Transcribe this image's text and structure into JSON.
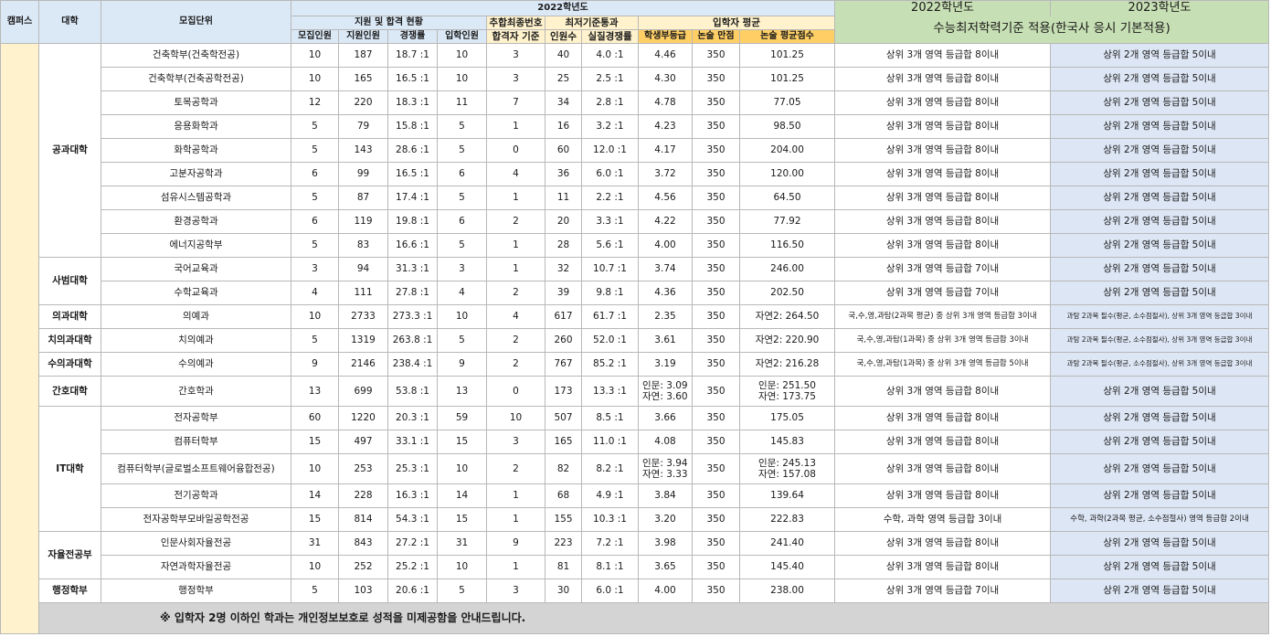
{
  "header": {
    "campus": "캠퍼스",
    "college": "대학",
    "unit": "모집단위",
    "year2022": "2022학년도",
    "group_apply": "지원 및 합격 현황",
    "group_extra": "추합최종번호",
    "group_min": "최저기준통과",
    "group_avg": "입학자 평균",
    "col_recruit": "모집인원",
    "col_applicants": "지원인원",
    "col_ratio": "경쟁률",
    "col_admitted": "입학인원",
    "col_extra": "합격자 기준",
    "col_passcount": "인원수",
    "col_realratio": "실질경쟁률",
    "col_grade": "학생부등급",
    "col_essay_full": "논술 만점",
    "col_essay_avg": "논술 평균점수",
    "csat_2022_year": "2022학년도",
    "csat_2023_year": "2023학년도",
    "csat_title": "수능최저학력기준 적용(한국사 응시 기본적용)"
  },
  "colleges": {
    "eng": "공과대학",
    "edu": "사범대학",
    "med": "의과대학",
    "dent": "치의과대학",
    "vet": "수의과대학",
    "nurse": "간호대학",
    "it": "IT대학",
    "free": "자율전공부",
    "admin": "행정학부"
  },
  "rows": [
    {
      "unit": "건축학부(건축학전공)",
      "recruit": "10",
      "applicants": "187",
      "ratio": "18.7 :1",
      "admitted": "10",
      "extra": "3",
      "pass": "40",
      "real": "4.0 :1",
      "grade": "4.46",
      "full": "350",
      "avg": "101.25",
      "c22": "상위 3개 영역 등급합 8이내",
      "c23": "상위 2개 영역 등급합 5이내"
    },
    {
      "unit": "건축학부(건축공학전공)",
      "recruit": "10",
      "applicants": "165",
      "ratio": "16.5 :1",
      "admitted": "10",
      "extra": "3",
      "pass": "25",
      "real": "2.5 :1",
      "grade": "4.30",
      "full": "350",
      "avg": "101.25",
      "c22": "상위 3개 영역 등급합 8이내",
      "c23": "상위 2개 영역 등급합 5이내"
    },
    {
      "unit": "토목공학과",
      "recruit": "12",
      "applicants": "220",
      "ratio": "18.3 :1",
      "admitted": "11",
      "extra": "7",
      "pass": "34",
      "real": "2.8 :1",
      "grade": "4.78",
      "full": "350",
      "avg": "77.05",
      "c22": "상위 3개 영역 등급합 8이내",
      "c23": "상위 2개 영역 등급합 5이내"
    },
    {
      "unit": "응용화학과",
      "recruit": "5",
      "applicants": "79",
      "ratio": "15.8 :1",
      "admitted": "5",
      "extra": "1",
      "pass": "16",
      "real": "3.2 :1",
      "grade": "4.23",
      "full": "350",
      "avg": "98.50",
      "c22": "상위 3개 영역 등급합 8이내",
      "c23": "상위 2개 영역 등급합 5이내"
    },
    {
      "unit": "화학공학과",
      "recruit": "5",
      "applicants": "143",
      "ratio": "28.6 :1",
      "admitted": "5",
      "extra": "0",
      "pass": "60",
      "real": "12.0 :1",
      "grade": "4.17",
      "full": "350",
      "avg": "204.00",
      "c22": "상위 3개 영역 등급합 8이내",
      "c23": "상위 2개 영역 등급합 5이내"
    },
    {
      "unit": "고분자공학과",
      "recruit": "6",
      "applicants": "99",
      "ratio": "16.5 :1",
      "admitted": "6",
      "extra": "4",
      "pass": "36",
      "real": "6.0 :1",
      "grade": "3.72",
      "full": "350",
      "avg": "120.00",
      "c22": "상위 3개 영역 등급합 8이내",
      "c23": "상위 2개 영역 등급합 5이내"
    },
    {
      "unit": "섬유시스템공학과",
      "recruit": "5",
      "applicants": "87",
      "ratio": "17.4 :1",
      "admitted": "5",
      "extra": "1",
      "pass": "11",
      "real": "2.2 :1",
      "grade": "4.56",
      "full": "350",
      "avg": "64.50",
      "c22": "상위 3개 영역 등급합 8이내",
      "c23": "상위 2개 영역 등급합 5이내"
    },
    {
      "unit": "환경공학과",
      "recruit": "6",
      "applicants": "119",
      "ratio": "19.8 :1",
      "admitted": "6",
      "extra": "2",
      "pass": "20",
      "real": "3.3 :1",
      "grade": "4.22",
      "full": "350",
      "avg": "77.92",
      "c22": "상위 3개 영역 등급합 8이내",
      "c23": "상위 2개 영역 등급합 5이내"
    },
    {
      "unit": "에너지공학부",
      "recruit": "5",
      "applicants": "83",
      "ratio": "16.6 :1",
      "admitted": "5",
      "extra": "1",
      "pass": "28",
      "real": "5.6 :1",
      "grade": "4.00",
      "full": "350",
      "avg": "116.50",
      "c22": "상위 3개 영역 등급합 8이내",
      "c23": "상위 2개 영역 등급합 5이내"
    },
    {
      "unit": "국어교육과",
      "recruit": "3",
      "applicants": "94",
      "ratio": "31.3 :1",
      "admitted": "3",
      "extra": "1",
      "pass": "32",
      "real": "10.7 :1",
      "grade": "3.74",
      "full": "350",
      "avg": "246.00",
      "c22": "상위 3개 영역 등급합 7이내",
      "c23": "상위 2개 영역 등급합 5이내"
    },
    {
      "unit": "수학교육과",
      "recruit": "4",
      "applicants": "111",
      "ratio": "27.8 :1",
      "admitted": "4",
      "extra": "2",
      "pass": "39",
      "real": "9.8 :1",
      "grade": "4.36",
      "full": "350",
      "avg": "202.50",
      "c22": "상위 3개 영역 등급합 7이내",
      "c23": "상위 2개 영역 등급합 5이내"
    },
    {
      "unit": "의예과",
      "recruit": "10",
      "applicants": "2733",
      "ratio": "273.3 :1",
      "admitted": "10",
      "extra": "4",
      "pass": "617",
      "real": "61.7 :1",
      "grade": "2.35",
      "full": "350",
      "avg": "자연2: 264.50",
      "c22": "국,수,영,과탐(2과목 평균) 중 상위 3개 영역 등급합 3이내",
      "c23": "과탐 2과목 필수(평균, 소수점절사), 상위 3개 영역 등급합 3이내"
    },
    {
      "unit": "치의예과",
      "recruit": "5",
      "applicants": "1319",
      "ratio": "263.8 :1",
      "admitted": "5",
      "extra": "2",
      "pass": "260",
      "real": "52.0 :1",
      "grade": "3.61",
      "full": "350",
      "avg": "자연2: 220.90",
      "c22": "국,수,영,과탐(1과목) 중 상위 3개 영역 등급합 3이내",
      "c23": "과탐 2과목 필수(평균, 소수점절사), 상위 3개 영역 등급합 3이내"
    },
    {
      "unit": "수의예과",
      "recruit": "9",
      "applicants": "2146",
      "ratio": "238.4 :1",
      "admitted": "9",
      "extra": "2",
      "pass": "767",
      "real": "85.2 :1",
      "grade": "3.19",
      "full": "350",
      "avg": "자연2: 216.28",
      "c22": "국,수,영,과탐(1과목) 중 상위 3개 영역 등급합 5이내",
      "c23": "과탐 2과목 필수(평균, 소수점절사), 상위 3개 영역 등급합 3이내"
    },
    {
      "unit": "간호학과",
      "recruit": "13",
      "applicants": "699",
      "ratio": "53.8 :1",
      "admitted": "13",
      "extra": "0",
      "pass": "173",
      "real": "13.3 :1",
      "grade": "인문: 3.09",
      "grade2": "자연: 3.60",
      "full": "350",
      "avg": "인문: 251.50",
      "avg2": "자연: 173.75",
      "c22": "상위 3개 영역 등급합 8이내",
      "c23": "상위 2개 영역 등급합 5이내"
    },
    {
      "unit": "전자공학부",
      "recruit": "60",
      "applicants": "1220",
      "ratio": "20.3 :1",
      "admitted": "59",
      "extra": "10",
      "pass": "507",
      "real": "8.5 :1",
      "grade": "3.66",
      "full": "350",
      "avg": "175.05",
      "c22": "상위 3개 영역 등급합 8이내",
      "c23": "상위 2개 영역 등급합 5이내"
    },
    {
      "unit": "컴퓨터학부",
      "recruit": "15",
      "applicants": "497",
      "ratio": "33.1 :1",
      "admitted": "15",
      "extra": "3",
      "pass": "165",
      "real": "11.0 :1",
      "grade": "4.08",
      "full": "350",
      "avg": "145.83",
      "c22": "상위 3개 영역 등급합 8이내",
      "c23": "상위 2개 영역 등급합 5이내"
    },
    {
      "unit": "컴퓨터학부(글로벌소프트웨어융합전공)",
      "recruit": "10",
      "applicants": "253",
      "ratio": "25.3 :1",
      "admitted": "10",
      "extra": "2",
      "pass": "82",
      "real": "8.2 :1",
      "grade": "인문: 3.94",
      "grade2": "자연: 3.33",
      "full": "350",
      "avg": "인문: 245.13",
      "avg2": "자연: 157.08",
      "c22": "상위 3개 영역 등급합 8이내",
      "c23": "상위 2개 영역 등급합 5이내"
    },
    {
      "unit": "전기공학과",
      "recruit": "14",
      "applicants": "228",
      "ratio": "16.3 :1",
      "admitted": "14",
      "extra": "1",
      "pass": "68",
      "real": "4.9 :1",
      "grade": "3.84",
      "full": "350",
      "avg": "139.64",
      "c22": "상위 3개 영역 등급합 8이내",
      "c23": "상위 2개 영역 등급합 5이내"
    },
    {
      "unit": "전자공학부모바일공학전공",
      "recruit": "15",
      "applicants": "814",
      "ratio": "54.3 :1",
      "admitted": "15",
      "extra": "1",
      "pass": "155",
      "real": "10.3 :1",
      "grade": "3.20",
      "full": "350",
      "avg": "222.83",
      "c22": "수학, 과학 영역 등급합 3이내",
      "c23": "수학, 과학(2과목 평균, 소수점절사) 영역 등급합 2이내"
    },
    {
      "unit": "인문사회자율전공",
      "recruit": "31",
      "applicants": "843",
      "ratio": "27.2 :1",
      "admitted": "31",
      "extra": "9",
      "pass": "223",
      "real": "7.2 :1",
      "grade": "3.98",
      "full": "350",
      "avg": "241.40",
      "c22": "상위 3개 영역 등급합 8이내",
      "c23": "상위 2개 영역 등급합 5이내"
    },
    {
      "unit": "자연과학자율전공",
      "recruit": "10",
      "applicants": "252",
      "ratio": "25.2 :1",
      "admitted": "10",
      "extra": "1",
      "pass": "81",
      "real": "8.1 :1",
      "grade": "3.65",
      "full": "350",
      "avg": "145.40",
      "c22": "상위 3개 영역 등급합 8이내",
      "c23": "상위 2개 영역 등급합 5이내"
    },
    {
      "unit": "행정학부",
      "recruit": "5",
      "applicants": "103",
      "ratio": "20.6 :1",
      "admitted": "5",
      "extra": "3",
      "pass": "30",
      "real": "6.0 :1",
      "grade": "4.00",
      "full": "350",
      "avg": "238.00",
      "c22": "상위 3개 영역 등급합 7이내",
      "c23": "상위 2개 영역 등급합 5이내"
    }
  ],
  "footnote": "※ 입학자 2명 이하인 학과는 개인정보보호로 성적을 미제공함을 안내드립니다."
}
